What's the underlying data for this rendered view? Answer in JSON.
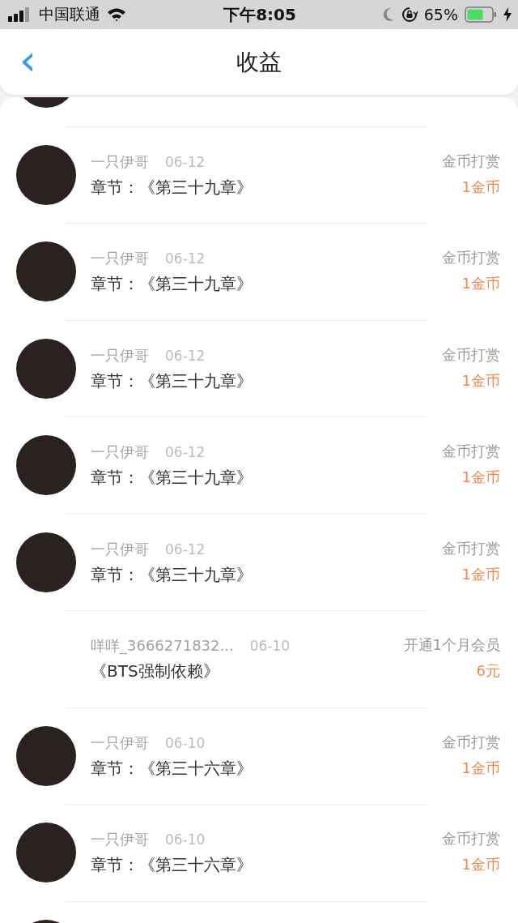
{
  "status_bar": {
    "carrier": "中国联通",
    "time": "下午8:05",
    "battery_percent": "65%"
  },
  "header": {
    "back": "‹",
    "title": "收益"
  },
  "rows": [
    {
      "kind": "clipped"
    },
    {
      "kind": "avatar",
      "user": "一只伊哥",
      "date": "06-12",
      "item": "章节：《第三十九章》",
      "type": "金币打赏",
      "amount": "1金币"
    },
    {
      "kind": "avatar",
      "user": "一只伊哥",
      "date": "06-12",
      "item": "章节：《第三十九章》",
      "type": "金币打赏",
      "amount": "1金币"
    },
    {
      "kind": "avatar",
      "user": "一只伊哥",
      "date": "06-12",
      "item": "章节：《第三十九章》",
      "type": "金币打赏",
      "amount": "1金币"
    },
    {
      "kind": "avatar",
      "user": "一只伊哥",
      "date": "06-12",
      "item": "章节：《第三十九章》",
      "type": "金币打赏",
      "amount": "1金币"
    },
    {
      "kind": "avatar",
      "user": "一只伊哥",
      "date": "06-12",
      "item": "章节：《第三十九章》",
      "type": "金币打赏",
      "amount": "1金币"
    },
    {
      "kind": "plain",
      "user": "咩咩_3666271832...",
      "date": "06-10",
      "item": "《BTS强制依赖》",
      "type": "开通1个月会员",
      "amount": "6元"
    },
    {
      "kind": "avatar",
      "user": "一只伊哥",
      "date": "06-10",
      "item": "章节：《第三十六章》",
      "type": "金币打赏",
      "amount": "1金币"
    },
    {
      "kind": "avatar",
      "user": "一只伊哥",
      "date": "06-10",
      "item": "章节：《第三十六章》",
      "type": "金币打赏",
      "amount": "1金币"
    },
    {
      "kind": "clipped"
    }
  ]
}
